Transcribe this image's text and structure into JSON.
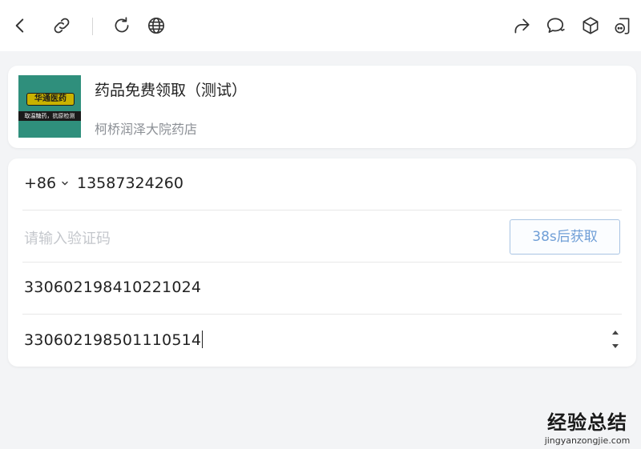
{
  "toolbar": {
    "back_icon": "back-chevron-icon",
    "link_icon": "link-icon",
    "refresh_icon": "refresh-icon",
    "globe_icon": "globe-icon",
    "share_icon": "share-icon",
    "chat_icon": "chat-bubble-icon",
    "box_icon": "cube-icon",
    "mini_icon": "miniprogram-icon"
  },
  "store": {
    "thumb_top_text": "华通医药",
    "thumb_bottom_text": "取温糖药，抗原检测",
    "title": "药品免费领取（测试）",
    "subtitle": "柯桥润泽大院药店"
  },
  "form": {
    "country_code": "+86",
    "phone": "13587324260",
    "code_placeholder": "请输入验证码",
    "code_button": "38s后获取",
    "id_number_1": "330602198410221024",
    "id_number_2": "330602198501110514"
  },
  "watermark": {
    "title": "经验总结",
    "url": "jingyanzongjie.com"
  },
  "colors": {
    "accent": "#6f9ed6",
    "thumb_bg": "#2f8f7c",
    "watermark_red": "#d43c2c"
  }
}
